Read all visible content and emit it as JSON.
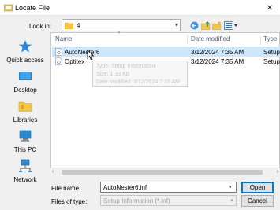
{
  "window": {
    "title": "Locate File",
    "close_glyph": "✕"
  },
  "lookin": {
    "label": "Look in:",
    "value": "4",
    "dropdown_glyph": "▾"
  },
  "toolbar": {
    "back_icon": "back-icon",
    "up_icon": "up-folder-icon",
    "new_folder_icon": "new-folder-icon",
    "view_icon": "view-menu-icon"
  },
  "places": [
    {
      "label": "Quick access",
      "icon": "star-icon"
    },
    {
      "label": "Desktop",
      "icon": "desktop-icon"
    },
    {
      "label": "Libraries",
      "icon": "libraries-icon"
    },
    {
      "label": "This PC",
      "icon": "computer-icon"
    },
    {
      "label": "Network",
      "icon": "network-icon"
    }
  ],
  "columns": {
    "name": "Name",
    "date": "Date modified",
    "type": "Type",
    "sort_glyph": "^"
  },
  "files": [
    {
      "name": "AutoNester6",
      "date": "3/12/2024 7:35 AM",
      "type": "Setup",
      "selected": true
    },
    {
      "name": "Optitex",
      "date": "3/12/2024 7:35 AM",
      "type": "Setup",
      "selected": false
    }
  ],
  "tooltip": {
    "type_line": "Type: Setup Information",
    "size_line": "Size: 1.33 KB",
    "date_line": "Date modified: 3/12/2024 7:35 AM"
  },
  "scroll": {
    "left_glyph": "‹",
    "right_glyph": "›"
  },
  "filename": {
    "label": "File name:",
    "value": "AutoNester6.inf",
    "dropdown_glyph": "▾"
  },
  "filetype": {
    "label": "Files of type:",
    "value": "Setup Information (*.inf)",
    "dropdown_glyph": "▾"
  },
  "buttons": {
    "open": "Open",
    "cancel": "Cancel"
  },
  "colors": {
    "selection": "#cce8ff",
    "accent": "#0078d7",
    "folder": "#f5c542"
  }
}
